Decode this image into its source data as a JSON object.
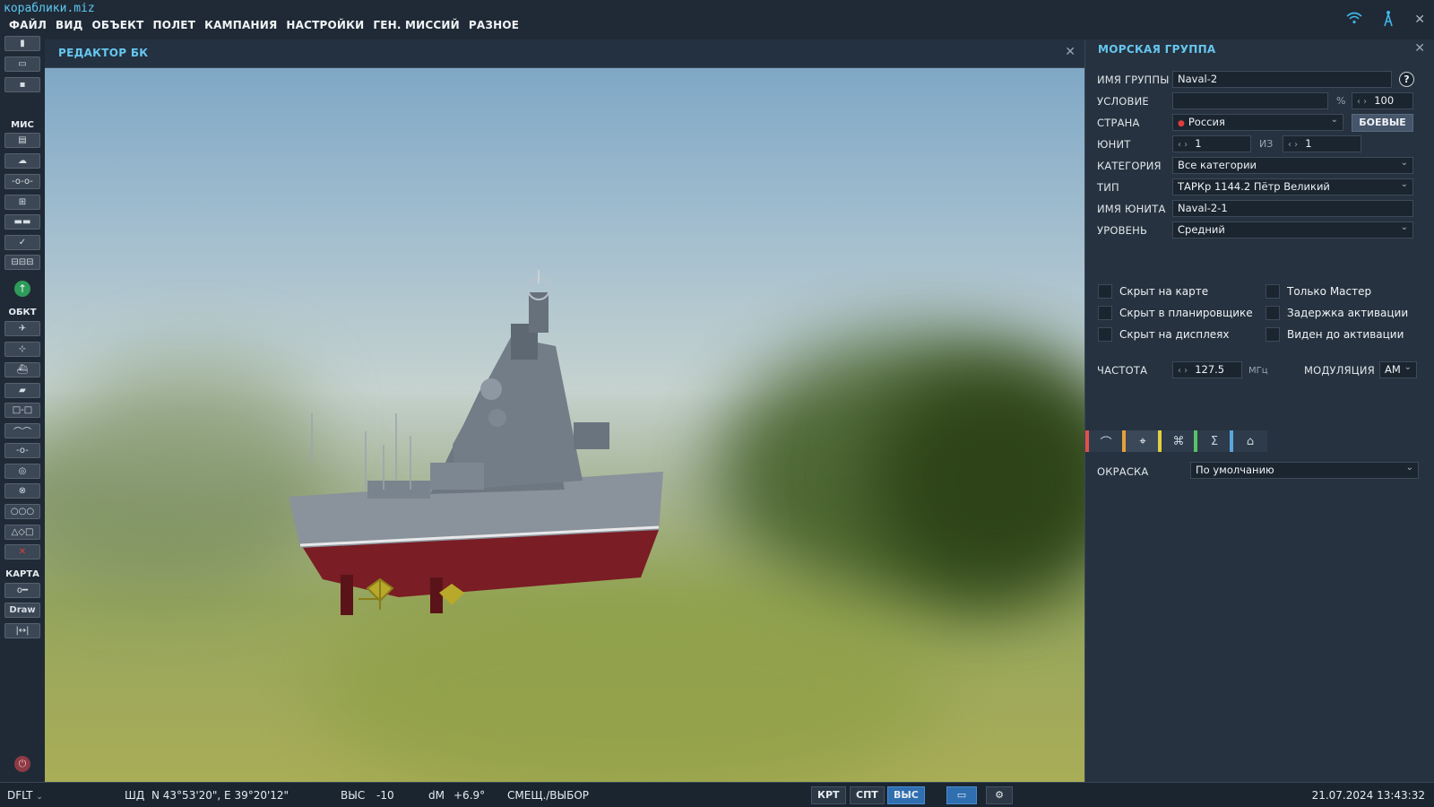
{
  "app": {
    "title": "кораблики.miz"
  },
  "menu": [
    "ФАЙЛ",
    "ВИД",
    "ОБЪЕКТ",
    "ПОЛЕТ",
    "КАМПАНИЯ",
    "НАСТРОЙКИ",
    "ГЕН. МИССИЙ",
    "РАЗНОЕ"
  ],
  "toolbar": {
    "sections": {
      "mission": "МИС",
      "objects": "ОБКТ",
      "map": "КАРТА"
    },
    "draw_label": "Draw"
  },
  "bk_editor": {
    "title": "РЕДАКТОР БК"
  },
  "panel": {
    "title": "МОРСКАЯ ГРУППА",
    "group_name": {
      "label": "ИМЯ ГРУППЫ",
      "value": "Naval-2"
    },
    "condition": {
      "label": "УСЛОВИЕ",
      "value": "",
      "unit": "%",
      "percent": "100"
    },
    "country": {
      "label": "СТРАНА",
      "value": "Россия",
      "button": "БОЕВЫЕ"
    },
    "unit": {
      "label": "ЮНИТ",
      "value": "1",
      "of_label": "ИЗ",
      "of_value": "1"
    },
    "category": {
      "label": "КАТЕГОРИЯ",
      "value": "Все категории"
    },
    "type": {
      "label": "ТИП",
      "value": "ТАРКр 1144.2 Пётр Великий"
    },
    "unit_name": {
      "label": "ИМЯ ЮНИТА",
      "value": "Naval-2-1"
    },
    "level": {
      "label": "УРОВЕНЬ",
      "value": "Средний"
    },
    "checkboxes": {
      "hidden_map": "Скрыт на карте",
      "hidden_planner": "Скрыт в планировщике",
      "hidden_displays": "Скрыт на дисплеях",
      "master_only": "Только Мастер",
      "late_activation": "Задержка активации",
      "visible_before": "Виден до активации"
    },
    "frequency": {
      "label": "ЧАСТОТА",
      "value": "127.5",
      "unit": "МГц"
    },
    "modulation": {
      "label": "МОДУЛЯЦИЯ",
      "value": "AM"
    },
    "paint": {
      "label": "ОКРАСКА",
      "value": "По умолчанию"
    },
    "tab_colors": [
      "#e0514a",
      "#e6a13a",
      "#e3d040",
      "#59c26a",
      "#5aa6e0"
    ]
  },
  "status": {
    "profile": "DFLT",
    "coords_label": "ШД",
    "coords": "N 43°53'20\", E 39°20'12\"",
    "alt_label": "ВЫС",
    "alt": "-10",
    "dm_label": "dM",
    "dm": "+6.9°",
    "mode": "СМЕЩ./ВЫБОР",
    "btn_map": "КРТ",
    "btn_sat": "СПТ",
    "btn_alt": "ВЫС",
    "datetime": "21.07.2024 13:43:32"
  }
}
